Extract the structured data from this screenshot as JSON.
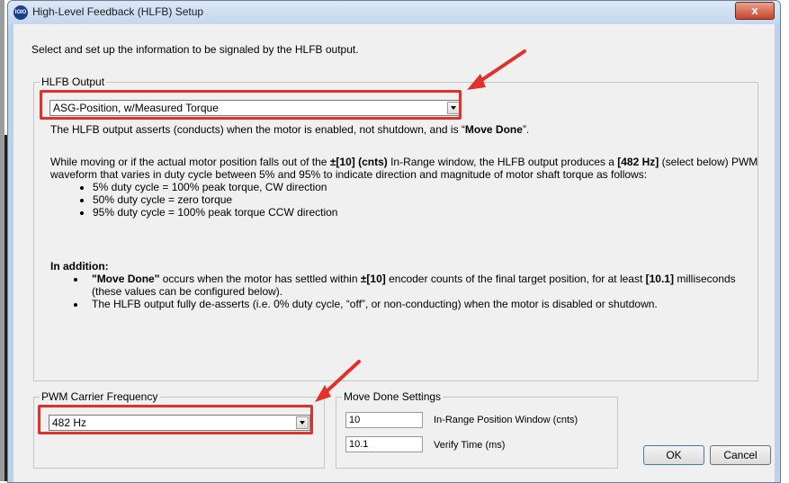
{
  "window": {
    "title": "High-Level Feedback (HLFB) Setup",
    "icon_text": "IOIO",
    "close_symbol": "x"
  },
  "intro": "Select and set up the information to be signaled by the HLFB output.",
  "hlfb_output": {
    "legend": "HLFB Output",
    "selected": "ASG-Position, w/Measured Torque",
    "line1": {
      "pre": "The HLFB output asserts (conducts) when the motor is enabled, not shutdown, and is “",
      "bold": "Move Done",
      "post": "”."
    },
    "para": {
      "p1": "While moving or if the actual motor position falls out of the ",
      "b1": "±[10] (cnts)",
      "p2": " In-Range window, the HLFB output produces a ",
      "b2": "[482 Hz]",
      "p3": " (select below) PWM waveform that varies in duty cycle between 5% and 95% to indicate direction and magnitude of motor shaft torque as follows:"
    },
    "bullets": [
      "5% duty cycle = 100% peak torque, CW direction",
      "50% duty cycle = zero torque",
      "95% duty cycle = 100% peak torque CCW direction"
    ],
    "addition_heading": "In addition:",
    "addition1": {
      "b1": "\"Move Done\"",
      "p1": " occurs when the motor has settled within ",
      "b2": "±[10]",
      "p2": " encoder counts of the final target position, for at least ",
      "b3": "[10.1]",
      "p3": " milliseconds (these values can be configured below)."
    },
    "addition2": "The HLFB output fully de-asserts (i.e. 0% duty cycle, “off”, or non-conducting) when the motor is disabled or shutdown."
  },
  "pwm": {
    "legend": "PWM Carrier Frequency",
    "selected": "482 Hz"
  },
  "move_done": {
    "legend": "Move Done Settings",
    "window_value": "10",
    "window_label": "In-Range Position Window (cnts)",
    "time_value": "10.1",
    "time_label": "Verify Time (ms)"
  },
  "buttons": {
    "ok": "OK",
    "cancel": "Cancel"
  },
  "colors": {
    "highlight": "#e0312b",
    "arrow": "#e0312b"
  }
}
